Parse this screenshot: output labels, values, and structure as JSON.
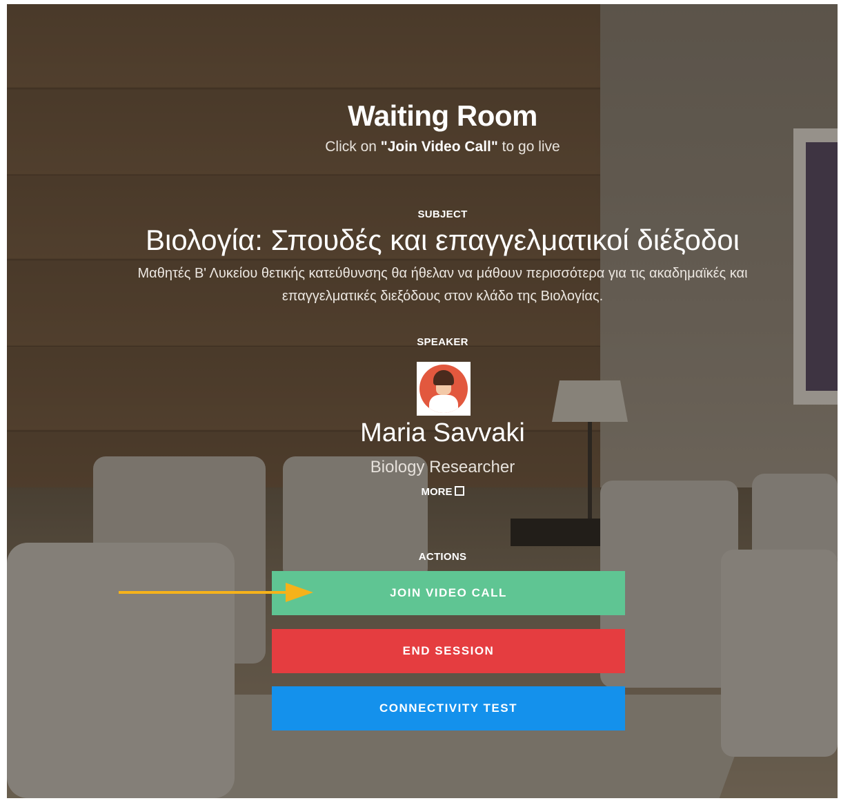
{
  "header": {
    "title": "Waiting Room",
    "subtitle_prefix": "Click on ",
    "subtitle_emphasis": "\"Join Video Call\"",
    "subtitle_suffix": " to go live"
  },
  "subject": {
    "label": "SUBJECT",
    "title": "Βιολογία: Σπουδές και επαγγελματικοί διέξοδοι",
    "description": "Μαθητές Β' Λυκείου θετικής κατεύθυνσης θα ήθελαν να μάθουν περισσότερα για τις ακαδημαϊκές και επαγγελματικές διεξόδους στον κλάδο της Βιολογίας."
  },
  "speaker": {
    "label": "SPEAKER",
    "avatar_icon": "avatar-icon",
    "name": "Maria Savvaki",
    "role": "Biology Researcher",
    "more_label": "MORE",
    "more_icon": "external-link-icon"
  },
  "actions": {
    "label": "ACTIONS",
    "join_label": "JOIN VIDEO CALL",
    "end_label": "END SESSION",
    "test_label": "CONNECTIVITY TEST",
    "colors": {
      "join": "#5fc593",
      "end": "#e53d40",
      "test": "#1491ec",
      "arrow": "#f6b21a"
    }
  }
}
